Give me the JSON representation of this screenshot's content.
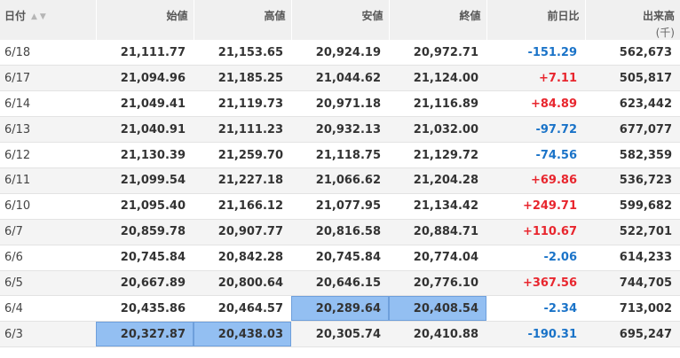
{
  "header": {
    "date": "日付",
    "sort_icons": "▲▼",
    "open": "始値",
    "high": "高値",
    "low": "安値",
    "close": "終値",
    "change": "前日比",
    "volume": "出来高",
    "volume_unit": "(千)"
  },
  "colors": {
    "up": "#e8262e",
    "down": "#1a73c8",
    "highlight": "#93bff2"
  },
  "rows": [
    {
      "date": "6/18",
      "open": "21,111.77",
      "high": "21,153.65",
      "low": "20,924.19",
      "close": "20,972.71",
      "change": "-151.29",
      "direction": "down",
      "volume": "562,673",
      "highlight": []
    },
    {
      "date": "6/17",
      "open": "21,094.96",
      "high": "21,185.25",
      "low": "21,044.62",
      "close": "21,124.00",
      "change": "+7.11",
      "direction": "up",
      "volume": "505,817",
      "highlight": []
    },
    {
      "date": "6/14",
      "open": "21,049.41",
      "high": "21,119.73",
      "low": "20,971.18",
      "close": "21,116.89",
      "change": "+84.89",
      "direction": "up",
      "volume": "623,442",
      "highlight": []
    },
    {
      "date": "6/13",
      "open": "21,040.91",
      "high": "21,111.23",
      "low": "20,932.13",
      "close": "21,032.00",
      "change": "-97.72",
      "direction": "down",
      "volume": "677,077",
      "highlight": []
    },
    {
      "date": "6/12",
      "open": "21,130.39",
      "high": "21,259.70",
      "low": "21,118.75",
      "close": "21,129.72",
      "change": "-74.56",
      "direction": "down",
      "volume": "582,359",
      "highlight": []
    },
    {
      "date": "6/11",
      "open": "21,099.54",
      "high": "21,227.18",
      "low": "21,066.62",
      "close": "21,204.28",
      "change": "+69.86",
      "direction": "up",
      "volume": "536,723",
      "highlight": []
    },
    {
      "date": "6/10",
      "open": "21,095.40",
      "high": "21,166.12",
      "low": "21,077.95",
      "close": "21,134.42",
      "change": "+249.71",
      "direction": "up",
      "volume": "599,682",
      "highlight": []
    },
    {
      "date": "6/7",
      "open": "20,859.78",
      "high": "20,907.77",
      "low": "20,816.58",
      "close": "20,884.71",
      "change": "+110.67",
      "direction": "up",
      "volume": "522,701",
      "highlight": []
    },
    {
      "date": "6/6",
      "open": "20,745.84",
      "high": "20,842.28",
      "low": "20,745.84",
      "close": "20,774.04",
      "change": "-2.06",
      "direction": "down",
      "volume": "614,233",
      "highlight": []
    },
    {
      "date": "6/5",
      "open": "20,667.89",
      "high": "20,800.64",
      "low": "20,646.15",
      "close": "20,776.10",
      "change": "+367.56",
      "direction": "up",
      "volume": "744,705",
      "highlight": []
    },
    {
      "date": "6/4",
      "open": "20,435.86",
      "high": "20,464.57",
      "low": "20,289.64",
      "close": "20,408.54",
      "change": "-2.34",
      "direction": "down",
      "volume": "713,002",
      "highlight": [
        "low",
        "close"
      ]
    },
    {
      "date": "6/3",
      "open": "20,327.87",
      "high": "20,438.03",
      "low": "20,305.74",
      "close": "20,410.88",
      "change": "-190.31",
      "direction": "down",
      "volume": "695,247",
      "highlight": [
        "open",
        "high"
      ]
    }
  ]
}
